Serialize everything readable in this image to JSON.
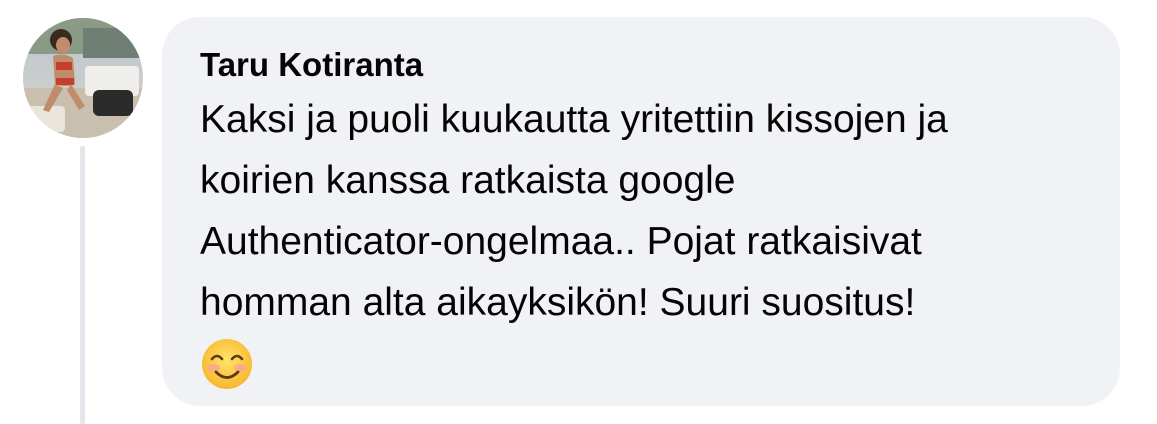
{
  "comment": {
    "author": "Taru Kotiranta",
    "text": "Kaksi ja puoli kuukautta yritettiin kissojen ja\nkoirien kanssa ratkaista google\nAuthenticator-ongelmaa.. Pojat ratkaisivat\nhomman alta aikayksikön! Suuri suositus!",
    "emoji_icon": "smiling-face-with-smiling-eyes-icon"
  },
  "colors": {
    "bubble_background": "#f0f2f5",
    "text": "#050505",
    "thread_line": "#e4e6eb"
  }
}
